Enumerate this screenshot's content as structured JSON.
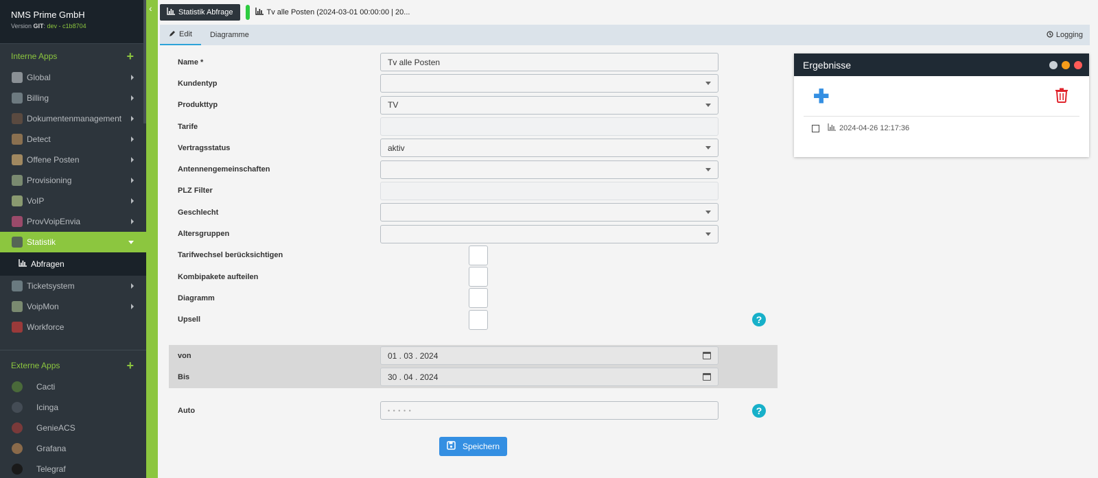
{
  "sidebar": {
    "brand_title": "NMS Prime GmbH",
    "version_prefix": "Version ",
    "version_git_label": "GIT",
    "version_git_value": "dev - c1b8704",
    "internal_header": "Interne Apps",
    "internal_items": [
      {
        "label": "Global",
        "icon": "globe-icon",
        "color": "#8a9095"
      },
      {
        "label": "Billing",
        "icon": "billing-icon",
        "color": "#6d7a80"
      },
      {
        "label": "Dokumentenmanagement",
        "icon": "document-icon",
        "color": "#5a4a40"
      },
      {
        "label": "Detect",
        "icon": "detect-icon",
        "color": "#8a7050"
      },
      {
        "label": "Offene Posten",
        "icon": "open-items-icon",
        "color": "#a08860"
      },
      {
        "label": "Provisioning",
        "icon": "provisioning-icon",
        "color": "#7a8a70"
      },
      {
        "label": "VoIP",
        "icon": "phone-icon",
        "color": "#8a9a70"
      },
      {
        "label": "ProvVoipEnvia",
        "icon": "envia-icon",
        "color": "#9a4a6a"
      },
      {
        "label": "Statistik",
        "icon": "statistics-icon",
        "color": "#556655"
      }
    ],
    "active_item": "Statistik",
    "sub_item": "Abfragen",
    "internal_items_after": [
      {
        "label": "Ticketsystem",
        "icon": "ticket-icon",
        "color": "#6a7a80"
      },
      {
        "label": "VoipMon",
        "icon": "voipmon-icon",
        "color": "#7a8a70"
      },
      {
        "label": "Workforce",
        "icon": "workforce-icon",
        "color": "#9a3a3a"
      }
    ],
    "external_header": "Externe Apps",
    "external_items": [
      {
        "label": "Cacti",
        "icon": "cacti-icon",
        "color": "#4a6a3a"
      },
      {
        "label": "Icinga",
        "icon": "icinga-icon",
        "color": "#444c55"
      },
      {
        "label": "GenieACS",
        "icon": "genieacs-icon",
        "color": "#7a3a3a"
      },
      {
        "label": "Grafana",
        "icon": "grafana-icon",
        "color": "#8a6a4a"
      },
      {
        "label": "Telegraf",
        "icon": "telegraf-icon",
        "color": "#1a1a1a"
      }
    ]
  },
  "topbar": {
    "button_label": "Statistik Abfrage",
    "breadcrumb": "Tv alle Posten (2024-03-01 00:00:00 | 20..."
  },
  "tabs": {
    "edit": "Edit",
    "diagrams": "Diagramme",
    "logging": "Logging"
  },
  "form": {
    "name_label": "Name *",
    "name_value": "Tv alle Posten",
    "kundentyp_label": "Kundentyp",
    "kundentyp_value": "",
    "produkttyp_label": "Produkttyp",
    "produkttyp_value": "TV",
    "tarife_label": "Tarife",
    "vertragsstatus_label": "Vertragsstatus",
    "vertragsstatus_value": "aktiv",
    "antennen_label": "Antennengemeinschaften",
    "plz_label": "PLZ Filter",
    "geschlecht_label": "Geschlecht",
    "altersgruppen_label": "Altersgruppen",
    "tarifwechsel_label": "Tarifwechsel berücksichtigen",
    "kombipakete_label": "Kombipakete aufteilen",
    "diagramm_label": "Diagramm",
    "upsell_label": "Upsell",
    "von_label": "von",
    "von_value": "01 . 03 . 2024",
    "bis_label": "Bis",
    "bis_value": "30 . 04 . 2024",
    "auto_label": "Auto",
    "auto_placeholder": "• • • • •",
    "help_glyph": "?",
    "save_label": "Speichern"
  },
  "results": {
    "title": "Ergebnisse",
    "items": [
      {
        "timestamp": "2024-04-26 12:17:36"
      }
    ]
  }
}
